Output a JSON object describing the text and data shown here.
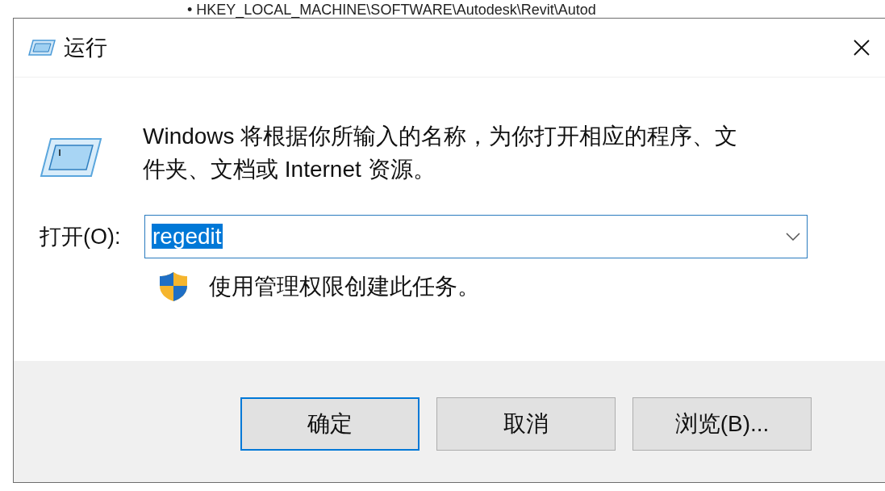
{
  "background_document": {
    "line": "• HKEY_LOCAL_MACHINE\\SOFTWARE\\Autodesk\\Revit\\Autod"
  },
  "window": {
    "title": "运行"
  },
  "description": "Windows 将根据你所输入的名称，为你打开相应的程序、文件夹、文档或 Internet 资源。",
  "open_field": {
    "label": "打开(O):",
    "value": "regedit",
    "selected": true
  },
  "admin_note": "使用管理权限创建此任务。",
  "buttons": [
    {
      "label": "确定",
      "default": true
    },
    {
      "label": "取消",
      "default": false
    },
    {
      "label": "浏览(B)...",
      "default": false
    }
  ]
}
